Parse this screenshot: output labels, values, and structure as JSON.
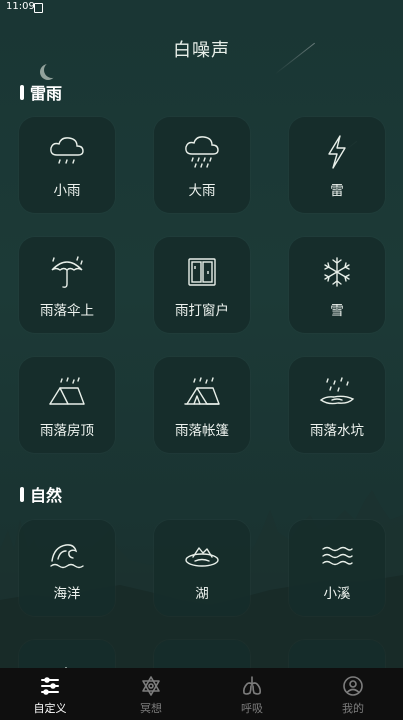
{
  "status_bar": {
    "time": "11:09"
  },
  "page_title": "白噪声",
  "sections": [
    {
      "title": "雷雨",
      "items": [
        {
          "label": "小雨",
          "icon": "cloud-drizzle-icon"
        },
        {
          "label": "大雨",
          "icon": "cloud-heavy-rain-icon"
        },
        {
          "label": "雷",
          "icon": "lightning-icon"
        },
        {
          "label": "雨落伞上",
          "icon": "umbrella-rain-icon"
        },
        {
          "label": "雨打窗户",
          "icon": "window-icon"
        },
        {
          "label": "雪",
          "icon": "snowflake-icon"
        },
        {
          "label": "雨落房顶",
          "icon": "roof-rain-icon"
        },
        {
          "label": "雨落帐篷",
          "icon": "tent-rain-icon"
        },
        {
          "label": "雨落水坑",
          "icon": "puddle-rain-icon"
        }
      ]
    },
    {
      "title": "自然",
      "items": [
        {
          "label": "海洋",
          "icon": "wave-icon"
        },
        {
          "label": "湖",
          "icon": "lake-icon"
        },
        {
          "label": "小溪",
          "icon": "stream-icon"
        }
      ]
    }
  ],
  "bottom_nav": [
    {
      "label": "自定义",
      "icon": "sliders-icon",
      "active": true
    },
    {
      "label": "冥想",
      "icon": "meditation-star-icon",
      "active": false
    },
    {
      "label": "呼吸",
      "icon": "lungs-icon",
      "active": false
    },
    {
      "label": "我的",
      "icon": "profile-icon",
      "active": false
    }
  ]
}
